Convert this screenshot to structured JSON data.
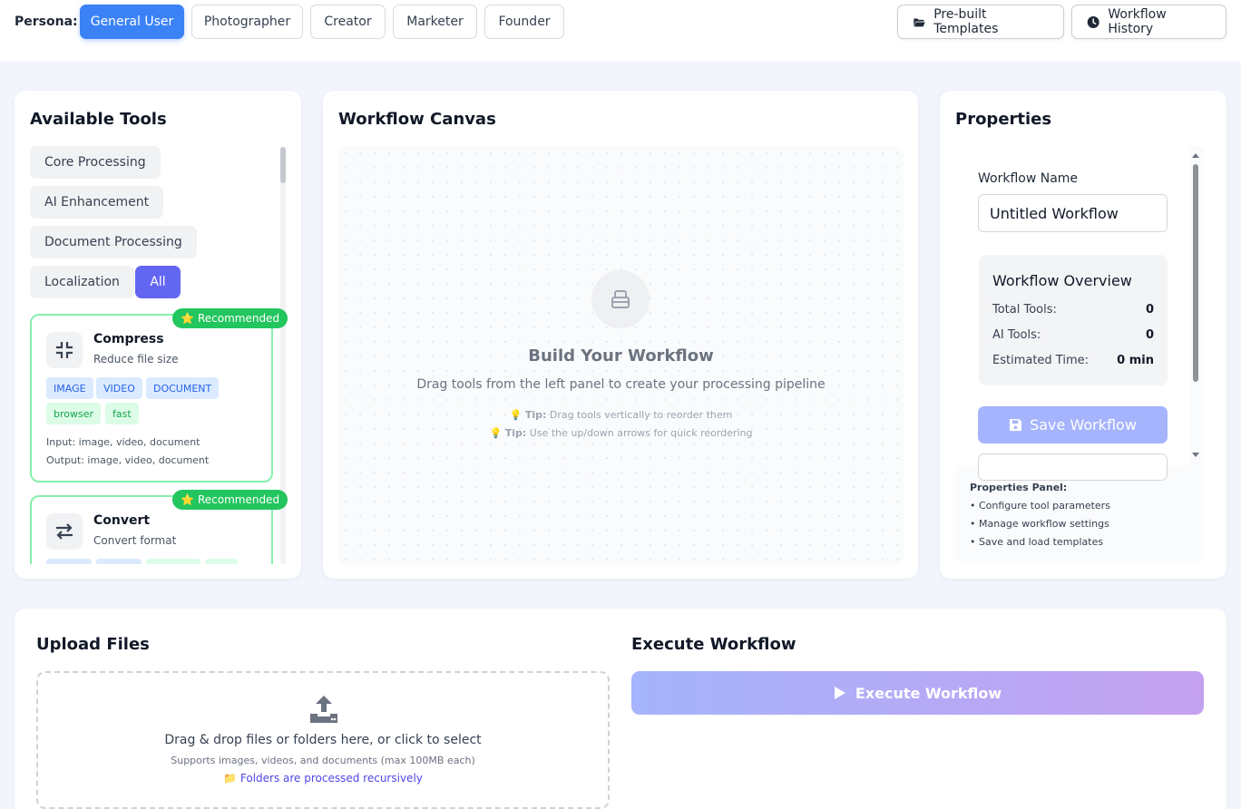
{
  "persona": {
    "label": "Persona:",
    "options": [
      "General User",
      "Photographer",
      "Creator",
      "Marketer",
      "Founder"
    ],
    "selected": "General User"
  },
  "header_actions": {
    "templates": "Pre-built Templates",
    "history": "Workflow History"
  },
  "tools_panel": {
    "title": "Available Tools",
    "categories": [
      "Core Processing",
      "AI Enhancement",
      "Document Processing",
      "Localization",
      "All"
    ],
    "active_category": "All",
    "tools": [
      {
        "name": "Compress",
        "description": "Reduce file size",
        "badge": "Recommended",
        "tags": [
          "IMAGE",
          "VIDEO",
          "DOCUMENT"
        ],
        "traits": [
          "browser",
          "fast"
        ],
        "input": "Input: image, video, document",
        "output": "Output: image, video, document",
        "icon": "compress-icon"
      },
      {
        "name": "Convert",
        "description": "Convert format",
        "badge": "Recommended",
        "icon": "convert-icon"
      }
    ]
  },
  "canvas": {
    "title": "Workflow Canvas",
    "empty_title": "Build Your Workflow",
    "empty_subtitle": "Drag tools from the left panel to create your processing pipeline",
    "tip_label": "Tip:",
    "tip1": "Drag tools vertically to reorder them",
    "tip2": "Use the up/down arrows for quick reordering"
  },
  "properties": {
    "title": "Properties",
    "name_label": "Workflow Name",
    "name_value": "Untitled Workflow",
    "overview": {
      "title": "Workflow Overview",
      "total_tools_label": "Total Tools:",
      "total_tools": "0",
      "ai_tools_label": "AI Tools:",
      "ai_tools": "0",
      "time_label": "Estimated Time:",
      "time": "0 min"
    },
    "save_label": "Save Workflow",
    "help": {
      "heading": "Properties Panel:",
      "items": [
        "• Configure tool parameters",
        "• Manage workflow settings",
        "• Save and load templates"
      ]
    }
  },
  "upload": {
    "title": "Upload Files",
    "main": "Drag & drop files or folders here, or click to select",
    "sub": "Supports images, videos, and documents (max 100MB each)",
    "folder_note": "📁 Folders are processed recursively"
  },
  "execute": {
    "title": "Execute Workflow",
    "button": "Execute Workflow"
  },
  "colors": {
    "primary": "#3b82f6",
    "accent": "#6366f1",
    "recommended": "#22c55e"
  }
}
